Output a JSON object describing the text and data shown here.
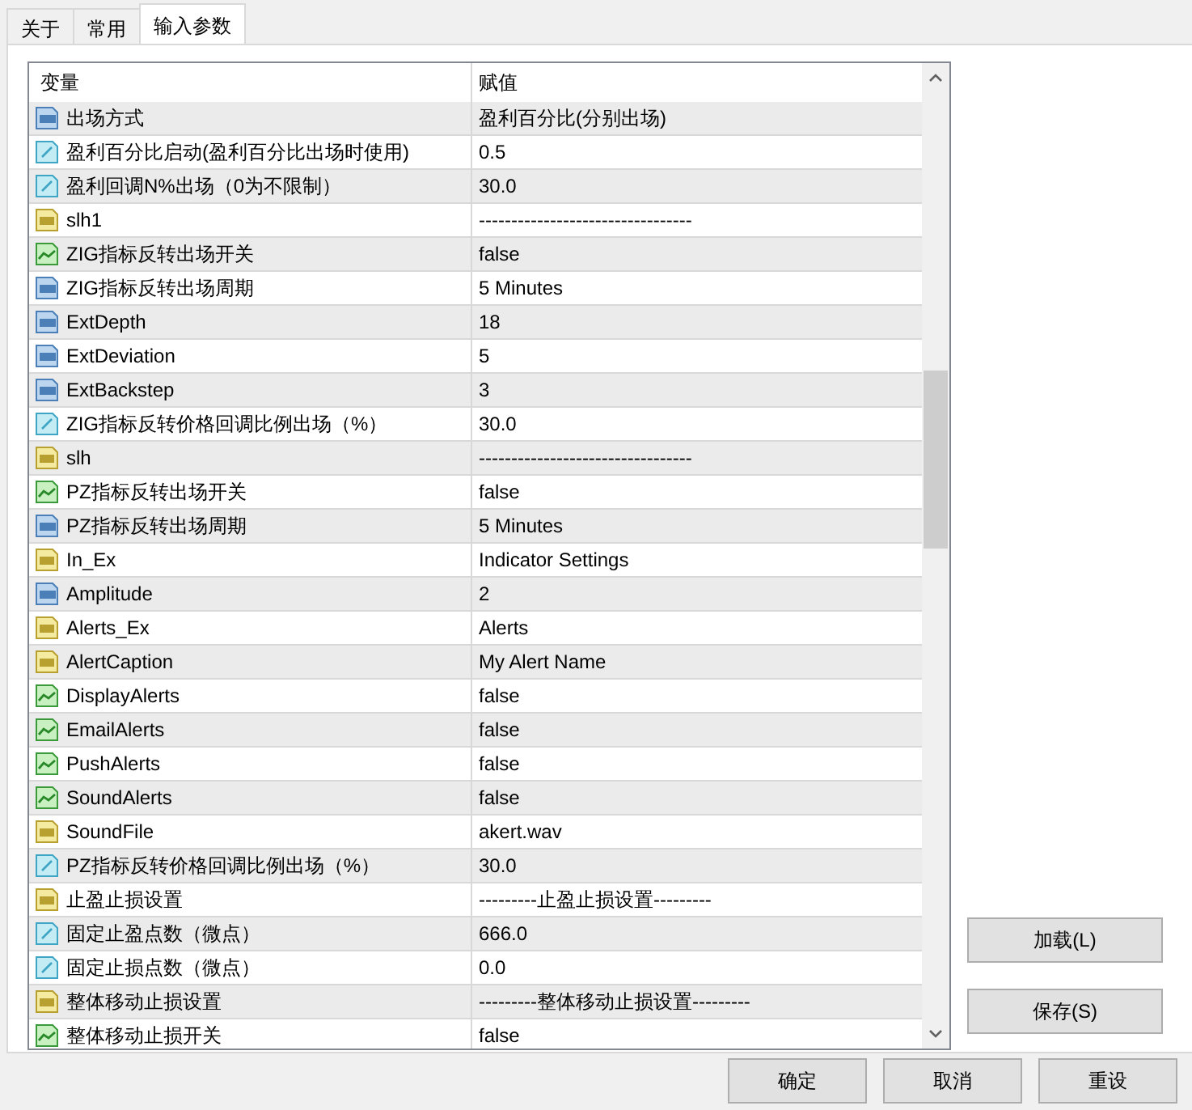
{
  "tabs": [
    {
      "label": "关于",
      "selected": false
    },
    {
      "label": "常用",
      "selected": false
    },
    {
      "label": "输入参数",
      "selected": true
    }
  ],
  "table": {
    "columns": [
      "变量",
      "赋值"
    ],
    "rows": [
      {
        "kind": "int",
        "name": "出场方式",
        "value": "盈利百分比(分别出场)"
      },
      {
        "kind": "double",
        "name": "盈利百分比启动(盈利百分比出场时使用)",
        "value": "0.5"
      },
      {
        "kind": "double",
        "name": "盈利回调N%出场（0为不限制）",
        "value": "30.0"
      },
      {
        "kind": "string",
        "name": "slh1",
        "value": "---------------------------------"
      },
      {
        "kind": "bool",
        "name": "ZIG指标反转出场开关",
        "value": "false"
      },
      {
        "kind": "int",
        "name": "ZIG指标反转出场周期",
        "value": "5 Minutes"
      },
      {
        "kind": "int",
        "name": "ExtDepth",
        "value": "18"
      },
      {
        "kind": "int",
        "name": "ExtDeviation",
        "value": "5"
      },
      {
        "kind": "int",
        "name": "ExtBackstep",
        "value": "3"
      },
      {
        "kind": "double",
        "name": "ZIG指标反转价格回调比例出场（%）",
        "value": "30.0"
      },
      {
        "kind": "string",
        "name": "slh",
        "value": "---------------------------------"
      },
      {
        "kind": "bool",
        "name": "PZ指标反转出场开关",
        "value": "false"
      },
      {
        "kind": "int",
        "name": "PZ指标反转出场周期",
        "value": "5 Minutes"
      },
      {
        "kind": "string",
        "name": "In_Ex",
        "value": "Indicator Settings"
      },
      {
        "kind": "int",
        "name": "Amplitude",
        "value": "2"
      },
      {
        "kind": "string",
        "name": "Alerts_Ex",
        "value": "Alerts"
      },
      {
        "kind": "string",
        "name": "AlertCaption",
        "value": "My Alert Name"
      },
      {
        "kind": "bool",
        "name": "DisplayAlerts",
        "value": "false"
      },
      {
        "kind": "bool",
        "name": "EmailAlerts",
        "value": "false"
      },
      {
        "kind": "bool",
        "name": "PushAlerts",
        "value": "false"
      },
      {
        "kind": "bool",
        "name": "SoundAlerts",
        "value": "false"
      },
      {
        "kind": "string",
        "name": "SoundFile",
        "value": "akert.wav"
      },
      {
        "kind": "double",
        "name": "PZ指标反转价格回调比例出场（%）",
        "value": "30.0"
      },
      {
        "kind": "string",
        "name": "止盈止损设置",
        "value": "---------止盈止损设置---------"
      },
      {
        "kind": "double",
        "name": "固定止盈点数（微点）",
        "value": "666.0"
      },
      {
        "kind": "double",
        "name": "固定止损点数（微点）",
        "value": "0.0"
      },
      {
        "kind": "string",
        "name": "整体移动止损设置",
        "value": "---------整体移动止损设置---------"
      },
      {
        "kind": "bool",
        "name": "整体移动止损开关",
        "value": "false"
      }
    ]
  },
  "side_buttons": [
    "加载(L)",
    "保存(S)"
  ],
  "buttons": [
    "确定",
    "取消",
    "重设"
  ]
}
